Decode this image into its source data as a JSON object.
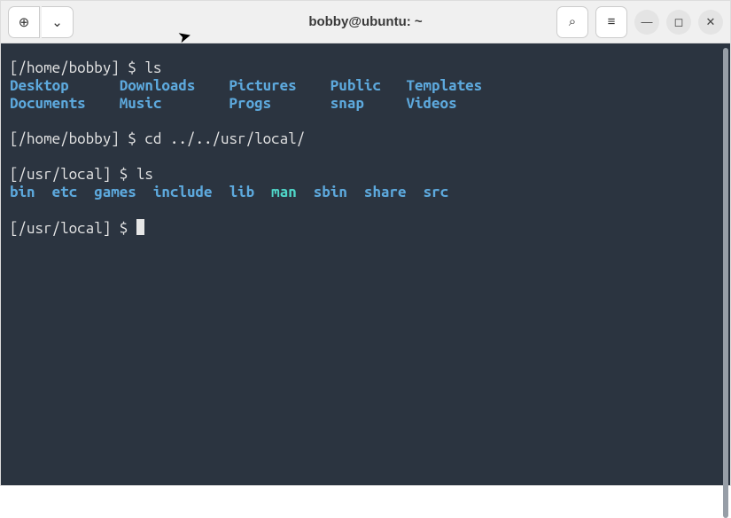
{
  "window": {
    "title": "bobby@ubuntu: ~"
  },
  "icons": {
    "new_tab": "⊕",
    "dropdown": "⌄",
    "search": "⌕",
    "menu": "≡",
    "minimize": "—",
    "maximize": "◻",
    "close": "✕",
    "pointer": "➤"
  },
  "terminal": {
    "prompts": {
      "home": "[/home/bobby] $ ",
      "usr_local": "[/usr/local] $ "
    },
    "commands": {
      "ls1": "ls",
      "cd": "cd ../../usr/local/",
      "ls2": "ls"
    },
    "listings": {
      "home_line1": {
        "c1": "Desktop",
        "c2": "Downloads",
        "c3": "Pictures",
        "c4": "Public",
        "c5": "Templates"
      },
      "home_line2": {
        "c1": "Documents",
        "c2": "Music",
        "c3": "Progs",
        "c4": "snap",
        "c5": "Videos"
      },
      "usr_local": {
        "c1": "bin",
        "c2": "etc",
        "c3": "games",
        "c4": "include",
        "c5": "lib",
        "c6": "man",
        "c7": "sbin",
        "c8": "share",
        "c9": "src"
      }
    }
  },
  "colors": {
    "terminal_bg": "#2b3440",
    "text": "#e6e6e6",
    "dir": "#5da9dd",
    "highlight": "#4fd6c8"
  }
}
